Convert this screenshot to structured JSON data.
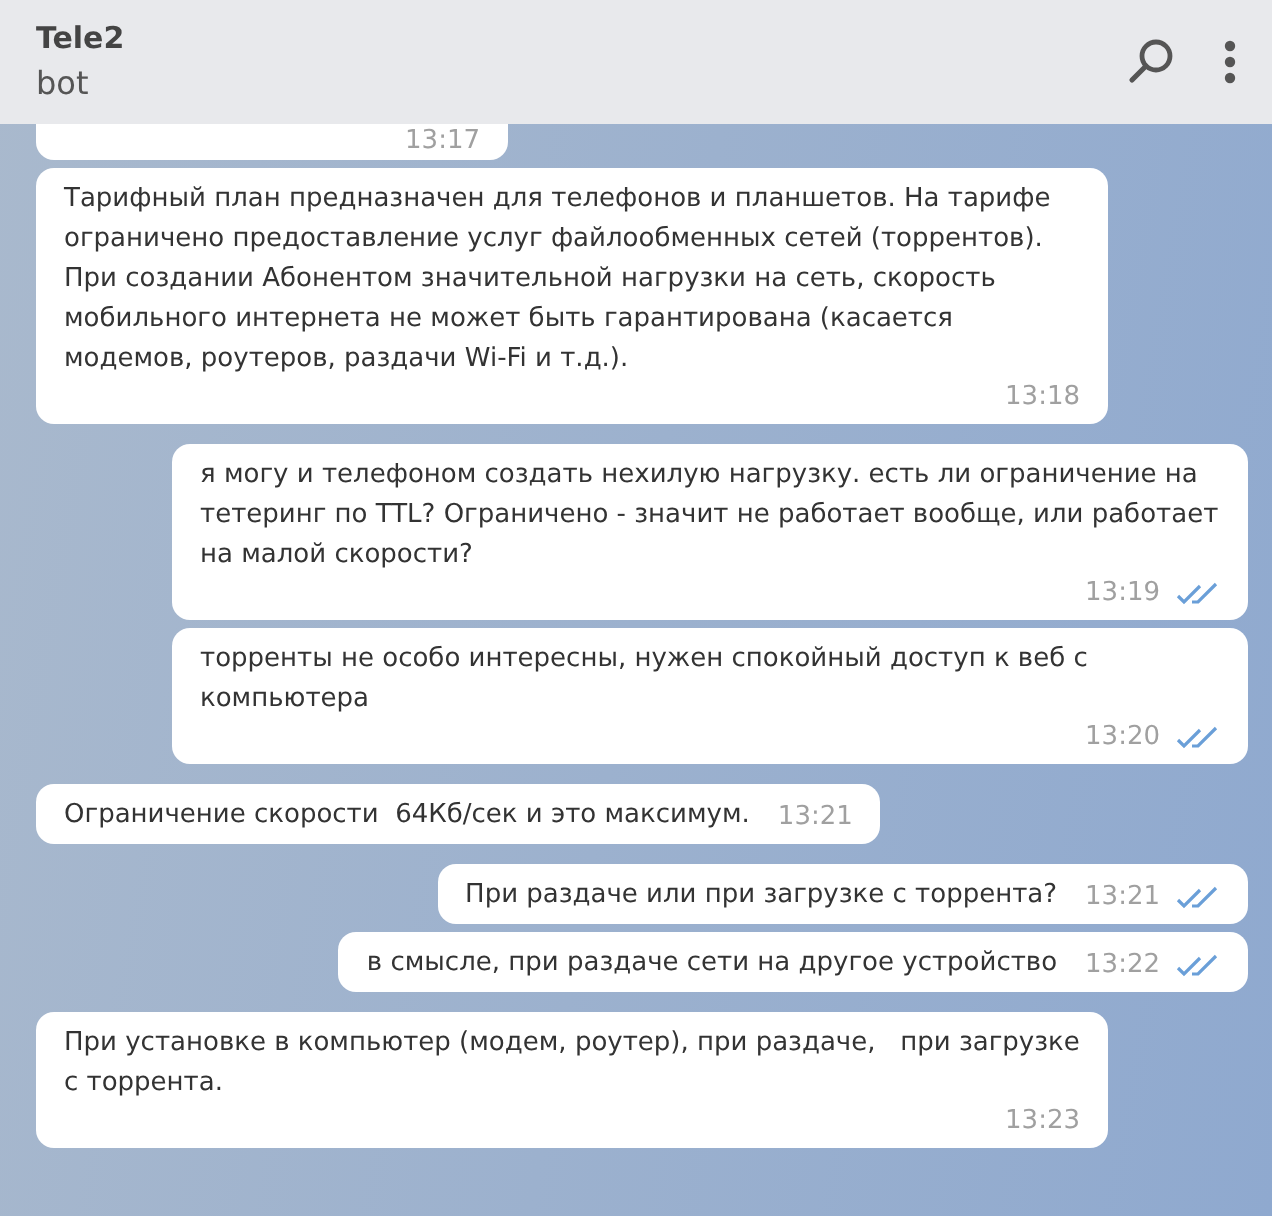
{
  "header": {
    "title": "Tele2",
    "subtitle": "bot"
  },
  "messages": [
    {
      "kind": "in",
      "time": "13:17"
    },
    {
      "kind": "in",
      "text": "Тарифный план предназначен для телефонов и планшетов. На тарифе ограничено предоставление услуг файлообменных сетей (торрентов). При создании Абонентом значительной нагрузки на сеть, скорость мобильного интернета не может быть гарантирована (касается модемов, роутеров, раздачи Wi-Fi и т.д.).",
      "time": "13:18"
    },
    {
      "kind": "out",
      "text": "я могу и телефоном создать нехилую нагрузку. есть ли ограничение на тетеринг по TTL? Ограничено - значит не работает вообще, или работает на малой скорости?",
      "time": "13:19",
      "read": true
    },
    {
      "kind": "out",
      "text": "торренты не особо интересны, нужен спокойный доступ к веб с компьютера",
      "time": "13:20",
      "read": true
    },
    {
      "kind": "in",
      "text": "Ограничение скорости  64Кб/сек и это максимум.",
      "time": "13:21"
    },
    {
      "kind": "out",
      "text": "При раздаче или при загрузке с торрента?",
      "time": "13:21",
      "read": true
    },
    {
      "kind": "out",
      "text": "в смысле, при раздаче сети на другое устройство",
      "time": "13:22",
      "read": true
    },
    {
      "kind": "in",
      "text": "При установке в компьютер (модем, роутер), при раздаче,   при загрузке с торрента.",
      "time": "13:23"
    }
  ]
}
